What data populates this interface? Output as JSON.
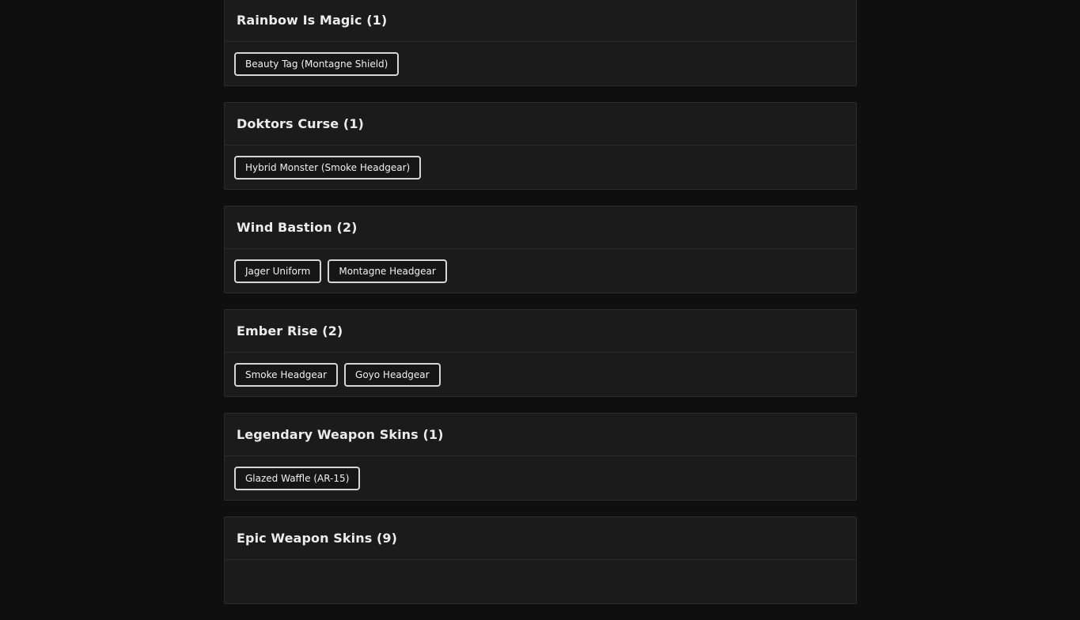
{
  "sections": [
    {
      "title": "Rainbow Is Magic (1)",
      "items": [
        "Beauty Tag (Montagne Shield)"
      ]
    },
    {
      "title": "Doktors Curse (1)",
      "items": [
        "Hybrid Monster (Smoke Headgear)"
      ]
    },
    {
      "title": "Wind Bastion (2)",
      "items": [
        "Jager Uniform",
        "Montagne Headgear"
      ]
    },
    {
      "title": "Ember Rise (2)",
      "items": [
        "Smoke Headgear",
        "Goyo Headgear"
      ]
    },
    {
      "title": "Legendary Weapon Skins (1)",
      "items": [
        "Glazed Waffle (AR-15)"
      ]
    },
    {
      "title": "Epic Weapon Skins (9)",
      "items": []
    }
  ]
}
